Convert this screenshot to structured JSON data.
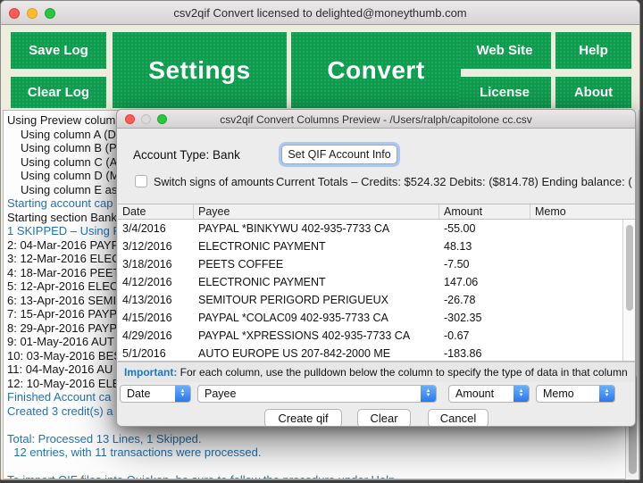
{
  "colors": {
    "button_green": "#0E9C4E",
    "log_blue": "#2374AE",
    "important_blue": "#1878C8",
    "popup_accent_blue": "#3E8EF7",
    "toolbar_beige": "#EDECDD"
  },
  "main_window": {
    "title": "csv2qif Convert licensed to delighted@moneythumb.com",
    "toolbar": {
      "save_log": "Save Log",
      "clear_log": "Clear Log",
      "settings": "Settings",
      "convert": "Convert",
      "web_site": "Web Site",
      "help": "Help",
      "license": "License",
      "about": "About"
    },
    "log_lines": [
      {
        "t": "Using Preview column",
        "c": "k"
      },
      {
        "t": "Using column A (D",
        "c": "k",
        "i": 1
      },
      {
        "t": "Using column B (Pa",
        "c": "k",
        "i": 1
      },
      {
        "t": "Using column C (A",
        "c": "k",
        "i": 1
      },
      {
        "t": "Using column D (M",
        "c": "k",
        "i": 1
      },
      {
        "t": "Using column E as",
        "c": "k",
        "i": 1
      },
      {
        "t": "Starting account cap",
        "c": "b"
      },
      {
        "t": "Starting section Bank:",
        "c": "k"
      },
      {
        "t": "1 SKIPPED – Using P",
        "c": "b"
      },
      {
        "t": "2: 04-Mar-2016 PAYP",
        "c": "k"
      },
      {
        "t": "3: 12-Mar-2016 ELEC",
        "c": "k"
      },
      {
        "t": "4: 18-Mar-2016 PEET",
        "c": "k"
      },
      {
        "t": "5: 12-Apr-2016 ELEC",
        "c": "k"
      },
      {
        "t": "6: 13-Apr-2016 SEMI",
        "c": "k"
      },
      {
        "t": "7: 15-Apr-2016 PAYP",
        "c": "k"
      },
      {
        "t": "8: 29-Apr-2016 PAYP",
        "c": "k"
      },
      {
        "t": "9: 01-May-2016 AUT",
        "c": "k"
      },
      {
        "t": "10: 03-May-2016 BES",
        "c": "k"
      },
      {
        "t": "11: 04-May-2016 AU",
        "c": "k"
      },
      {
        "t": "12: 10-May-2016 ELE",
        "c": "k"
      },
      {
        "t": "Finished Account ca",
        "c": "b"
      },
      {
        "t": "Created 3 credit(s) a",
        "c": "b"
      },
      {
        "t": "",
        "c": "k"
      },
      {
        "t": "Total: Processed 13 Lines, 1 Skipped.",
        "c": "b"
      },
      {
        "t": "  12 entries, with 11 transactions were processed.",
        "c": "b"
      },
      {
        "t": "",
        "c": "k"
      },
      {
        "t": "To import QIF files into Quicken, be sure to follow the procedure under Help.",
        "c": "b"
      }
    ]
  },
  "dialog": {
    "title": "csv2qif Convert Columns Preview - /Users/ralph/capitolone cc.csv",
    "account_type_label": "Account Type: Bank",
    "set_qif_button": "Set QIF Account Info",
    "switch_signs_label": "Switch signs of amounts",
    "totals_text": "Current Totals – Credits: $524.32  Debits: ($814.78)  Ending balance: (",
    "table": {
      "columns": [
        "Date",
        "Payee",
        "Amount",
        "Memo"
      ],
      "rows": [
        [
          "3/4/2016",
          "PAYPAL *BINKYWU 402-935-7733 CA",
          "-55.00",
          ""
        ],
        [
          "3/12/2016",
          "ELECTRONIC PAYMENT",
          "48.13",
          ""
        ],
        [
          "3/18/2016",
          "PEETS COFFEE",
          "-7.50",
          ""
        ],
        [
          "4/12/2016",
          "ELECTRONIC PAYMENT",
          "147.06",
          ""
        ],
        [
          "4/13/2016",
          "SEMITOUR PERIGORD PERIGUEUX",
          "-26.78",
          ""
        ],
        [
          "4/15/2016",
          "PAYPAL *COLAC09 402-935-7733 CA",
          "-302.35",
          ""
        ],
        [
          "4/29/2016",
          "PAYPAL *XPRESSIONS 402-935-7733 CA",
          "-0.67",
          ""
        ],
        [
          "5/1/2016",
          "AUTO EUROPE US 207-842-2000 ME",
          "-183.86",
          ""
        ]
      ]
    },
    "important_label": "Important:",
    "important_text": " For each column, use the pulldown below the column to specify the type of data in that column",
    "dropdowns": [
      "Date",
      "Payee",
      "Amount",
      "Memo"
    ],
    "buttons": {
      "create": "Create qif",
      "clear": "Clear",
      "cancel": "Cancel"
    }
  }
}
